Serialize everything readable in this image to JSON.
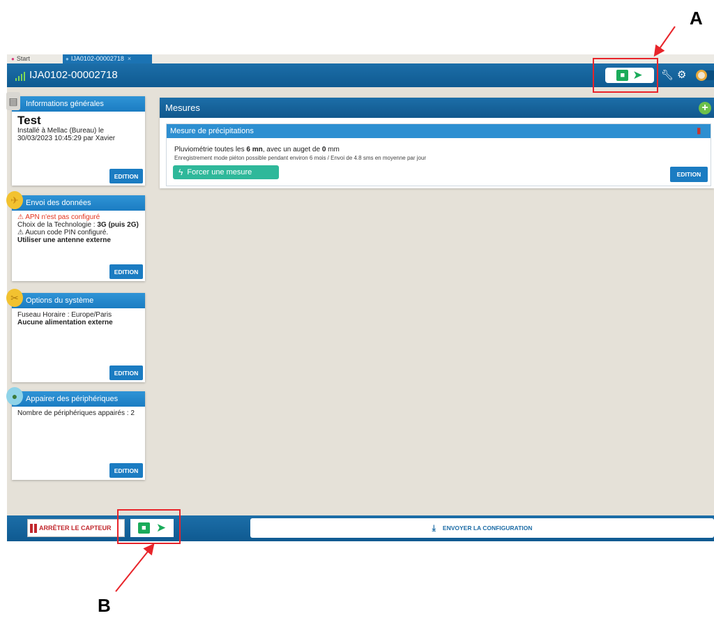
{
  "tabs": [
    {
      "label": "Start"
    },
    {
      "label": "IJA0102-00002718",
      "close": "×"
    }
  ],
  "header": {
    "title": "IJA0102-00002718"
  },
  "cards": {
    "general": {
      "title": "Informations générales",
      "name": "Test",
      "detail": "Installé à Mellac (Bureau) le 30/03/2023 10:45:29 par Xavier",
      "edit_label": "EDITION"
    },
    "send": {
      "title": "Envoi des données",
      "warning": "⚠ APN n'est pas configuré",
      "tech_prefix": "Choix de la Technologie : ",
      "tech_value": "3G (puis 2G)",
      "pin_line": "⚠ Aucun code PIN configuré.",
      "antenna": "Utiliser une antenne externe",
      "edit_label": "EDITION"
    },
    "system": {
      "title": "Options du système",
      "timezone": "Fuseau Horaire : Europe/Paris",
      "power": "Aucune alimentation externe",
      "edit_label": "EDITION"
    },
    "pair": {
      "title": "Appairer des périphériques",
      "count": "Nombre de périphériques appairés : 2",
      "edit_label": "EDITION"
    }
  },
  "mesures": {
    "title": "Mesures",
    "item_title": "Mesure de précipitations",
    "line1_a": "Pluviométrie toutes les ",
    "line1_b": "6 mn",
    "line1_c": ", avec un auget de ",
    "line1_d": "0",
    "line1_e": " mm",
    "line2": "Enregistrement mode piéton possible pendant environ 6 mois / Envoi de 4.8 sms en moyenne par jour",
    "force_label": "Forcer une mesure",
    "edit_label": "EDITION"
  },
  "footer": {
    "stop_label": "ARRÊTER LE CAPTEUR",
    "send_config_label": "ENVOYER LA CONFIGURATION"
  },
  "annotations": {
    "a": "A",
    "b": "B"
  },
  "colors": {
    "header_blue": "#1c6ea8",
    "card_blue": "#1b7cc2",
    "save_green": "#1aab5a",
    "warning_red": "#e3311a",
    "annotation_red": "#e8242a"
  },
  "icons": [
    "signal-icon",
    "save-icon",
    "send-icon",
    "wrench-icon",
    "gear-icon",
    "clipboard-icon",
    "paper-plane-icon",
    "tools-icon",
    "link-icon",
    "add-icon",
    "trash-icon",
    "bolt-icon",
    "stop-icon",
    "download-icon"
  ]
}
